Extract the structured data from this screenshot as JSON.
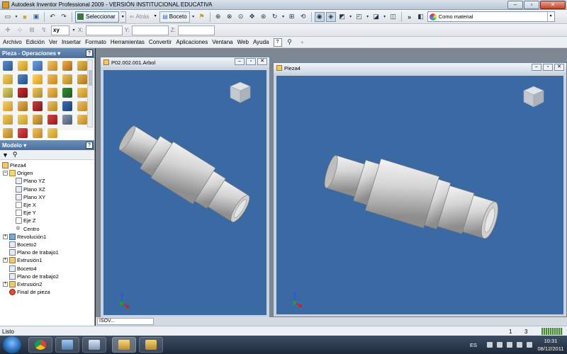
{
  "window": {
    "title": "Autodesk Inventor Professional 2009 - VERSIÓN INSTITUCIONAL EDUCATIVA",
    "minimize": "–",
    "maximize": "▫",
    "close": "✕"
  },
  "toolbar": {
    "select_label": "Seleccionar",
    "back_label": "Atrás",
    "sketch_label": "Boceto",
    "material": "Como material",
    "coord_mode": "xy",
    "x_label": "X:",
    "y_label": "Y:",
    "z_label": "Z:",
    "x_value": "",
    "y_value": "",
    "z_value": ""
  },
  "menu": {
    "items": [
      "Archivo",
      "Edición",
      "Ver",
      "Insertar",
      "Formato",
      "Herramientas",
      "Convertir",
      "Aplicaciones",
      "Ventana",
      "Web",
      "Ayuda"
    ]
  },
  "panels": {
    "operations_title": "Pieza - Operaciones ▾",
    "model_title": "Modelo ▾",
    "help": "?"
  },
  "tree": {
    "nodes": [
      {
        "label": "Pieza4",
        "level": 0,
        "icon": "part",
        "expand": ""
      },
      {
        "label": "Origen",
        "level": 1,
        "icon": "folder",
        "expand": "–"
      },
      {
        "label": "Plano YZ",
        "level": 2,
        "icon": "plane",
        "expand": ""
      },
      {
        "label": "Plano XZ",
        "level": 2,
        "icon": "plane",
        "expand": ""
      },
      {
        "label": "Plano XY",
        "level": 2,
        "icon": "plane",
        "expand": ""
      },
      {
        "label": "Eje X",
        "level": 2,
        "icon": "axis",
        "expand": ""
      },
      {
        "label": "Eje Y",
        "level": 2,
        "icon": "axis",
        "expand": ""
      },
      {
        "label": "Eje Z",
        "level": 2,
        "icon": "axis",
        "expand": ""
      },
      {
        "label": "Centro",
        "level": 2,
        "icon": "center",
        "expand": ""
      },
      {
        "label": "Revolución1",
        "level": 0,
        "icon": "rev",
        "expand": "+"
      },
      {
        "label": "Boceto2",
        "level": 0,
        "icon": "sketch",
        "expand": ""
      },
      {
        "label": "Plano de trabajo1",
        "level": 0,
        "icon": "plane",
        "expand": ""
      },
      {
        "label": "Extrusión1",
        "level": 0,
        "icon": "ext",
        "expand": "+"
      },
      {
        "label": "Boceto4",
        "level": 0,
        "icon": "sketch",
        "expand": ""
      },
      {
        "label": "Plano de trabajo2",
        "level": 0,
        "icon": "plane",
        "expand": ""
      },
      {
        "label": "Extrusión2",
        "level": 0,
        "icon": "ext",
        "expand": "+"
      },
      {
        "label": "Final de pieza",
        "level": 0,
        "icon": "end",
        "expand": ""
      }
    ]
  },
  "documents": [
    {
      "title": "P02.002.001.Arbol"
    },
    {
      "title": "Pieza4"
    }
  ],
  "tabstrip": {
    "tab": "ISOV..."
  },
  "status": {
    "text": "Listo",
    "count1": "1",
    "count2": "3"
  },
  "taskbar": {
    "lang": "ES",
    "time": "10:31",
    "date": "08/12/2011"
  },
  "colors": {
    "viewport": "#3a69a3",
    "shaft": "#c8c8c8",
    "panel_header": "#4a6f9d"
  }
}
